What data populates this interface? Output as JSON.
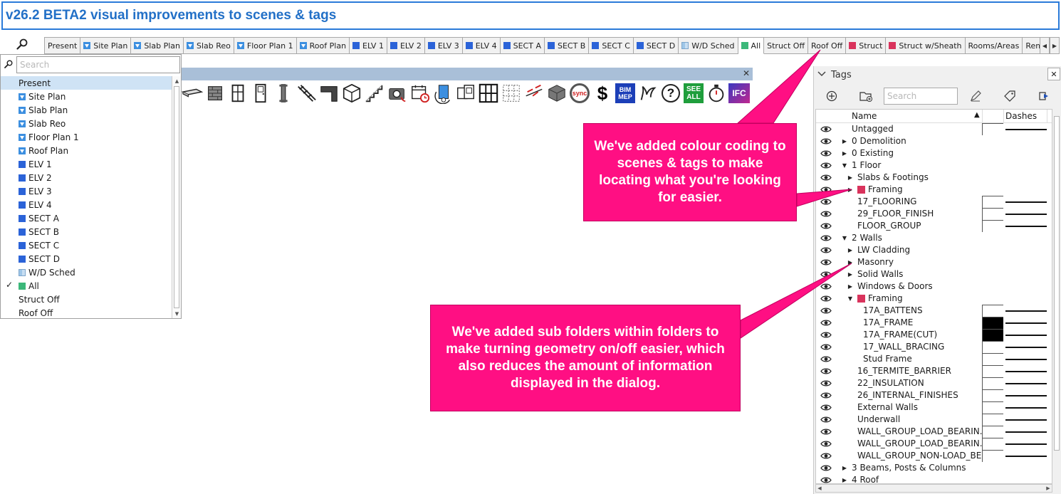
{
  "title": "v26.2 BETA2 visual improvements to scenes & tags",
  "scene_tabs": [
    {
      "label": "Present",
      "swatch": "none",
      "active": false
    },
    {
      "label": "Site Plan",
      "swatch": "tri",
      "active": false
    },
    {
      "label": "Slab Plan",
      "swatch": "tri",
      "active": false
    },
    {
      "label": "Slab Reo",
      "swatch": "tri",
      "active": false
    },
    {
      "label": "Floor Plan 1",
      "swatch": "tri",
      "active": false
    },
    {
      "label": "Roof Plan",
      "swatch": "tri",
      "active": false
    },
    {
      "label": "ELV 1",
      "swatch": "blue",
      "active": false
    },
    {
      "label": "ELV 2",
      "swatch": "blue",
      "active": false
    },
    {
      "label": "ELV 3",
      "swatch": "blue",
      "active": false
    },
    {
      "label": "ELV 4",
      "swatch": "blue",
      "active": false
    },
    {
      "label": "SECT A",
      "swatch": "blue",
      "active": false
    },
    {
      "label": "SECT B",
      "swatch": "blue",
      "active": false
    },
    {
      "label": "SECT C",
      "swatch": "blue",
      "active": false
    },
    {
      "label": "SECT D",
      "swatch": "blue",
      "active": false
    },
    {
      "label": "W/D Sched",
      "swatch": "grid",
      "active": false
    },
    {
      "label": "All",
      "swatch": "green",
      "active": true
    },
    {
      "label": "Struct Off",
      "swatch": "none",
      "active": false
    },
    {
      "label": "Roof Off",
      "swatch": "none",
      "active": false
    },
    {
      "label": "Struct",
      "swatch": "red",
      "active": false
    },
    {
      "label": "Struct w/Sheath",
      "swatch": "red",
      "active": false
    },
    {
      "label": "Rooms/Areas",
      "swatch": "none",
      "active": false
    },
    {
      "label": "Remen",
      "swatch": "none",
      "active": false
    }
  ],
  "scene_dropdown": {
    "search_placeholder": "Search",
    "items": [
      {
        "label": "Present",
        "swatch": "none",
        "checked": false,
        "selected": true
      },
      {
        "label": "Site Plan",
        "swatch": "tri",
        "checked": false,
        "selected": false
      },
      {
        "label": "Slab Plan",
        "swatch": "tri",
        "checked": false,
        "selected": false
      },
      {
        "label": "Slab Reo",
        "swatch": "tri",
        "checked": false,
        "selected": false
      },
      {
        "label": "Floor Plan 1",
        "swatch": "tri",
        "checked": false,
        "selected": false
      },
      {
        "label": "Roof Plan",
        "swatch": "tri",
        "checked": false,
        "selected": false
      },
      {
        "label": "ELV 1",
        "swatch": "blue",
        "checked": false,
        "selected": false
      },
      {
        "label": "ELV 2",
        "swatch": "blue",
        "checked": false,
        "selected": false
      },
      {
        "label": "ELV 3",
        "swatch": "blue",
        "checked": false,
        "selected": false
      },
      {
        "label": "ELV 4",
        "swatch": "blue",
        "checked": false,
        "selected": false
      },
      {
        "label": "SECT A",
        "swatch": "blue",
        "checked": false,
        "selected": false
      },
      {
        "label": "SECT B",
        "swatch": "blue",
        "checked": false,
        "selected": false
      },
      {
        "label": "SECT C",
        "swatch": "blue",
        "checked": false,
        "selected": false
      },
      {
        "label": "SECT D",
        "swatch": "blue",
        "checked": false,
        "selected": false
      },
      {
        "label": "W/D Sched",
        "swatch": "grid",
        "checked": false,
        "selected": false
      },
      {
        "label": "All",
        "swatch": "green",
        "checked": true,
        "selected": false
      },
      {
        "label": "Struct Off",
        "swatch": "none",
        "checked": false,
        "selected": false
      },
      {
        "label": "Roof Off",
        "swatch": "none",
        "checked": false,
        "selected": false
      }
    ]
  },
  "toolbar": {
    "tools": [
      {
        "name": "beam-tool-icon"
      },
      {
        "name": "wall-tool-icon"
      },
      {
        "name": "window-tool-icon"
      },
      {
        "name": "door-tool-icon"
      },
      {
        "name": "column-tool-icon"
      },
      {
        "name": "stair-stringer-tool-icon"
      },
      {
        "name": "corner-tool-icon"
      },
      {
        "name": "solid-tool-icon"
      },
      {
        "name": "stairs-tool-icon"
      },
      {
        "name": "camera-tool-icon"
      },
      {
        "name": "calendar-tool-icon"
      },
      {
        "name": "model-tool-icon"
      },
      {
        "name": "door-schedule-tool-icon"
      },
      {
        "name": "grid-tool-icon"
      },
      {
        "name": "dotted-grid-tool-icon"
      },
      {
        "name": "dimension-tool-icon"
      },
      {
        "name": "component-tool-icon"
      },
      {
        "name": "sync-tool-icon",
        "text": "sync"
      },
      {
        "name": "cost-tool-icon",
        "text": "$"
      },
      {
        "name": "bim-mep-tool-icon",
        "text": "BIM MEP"
      },
      {
        "name": "gesture-tool-icon"
      },
      {
        "name": "help-tool-icon",
        "text": "?"
      },
      {
        "name": "see-all-tool-icon",
        "text": "SEE ALL"
      },
      {
        "name": "timer-tool-icon"
      },
      {
        "name": "ifc-tool-icon",
        "text": "IFC"
      }
    ]
  },
  "tags_panel": {
    "title": "Tags",
    "search_placeholder": "Search",
    "columns": {
      "name": "Name",
      "dashes": "Dashes"
    },
    "rows": [
      {
        "label": "Untagged",
        "level": 0,
        "expander": "none",
        "swatch": false,
        "color_cell": "white",
        "dash": true
      },
      {
        "label": "0 Demolition",
        "level": 0,
        "expander": "collapsed",
        "swatch": false,
        "color_cell": "none",
        "dash": false
      },
      {
        "label": "0 Existing",
        "level": 0,
        "expander": "collapsed",
        "swatch": false,
        "color_cell": "none",
        "dash": false
      },
      {
        "label": "1 Floor",
        "level": 0,
        "expander": "expanded",
        "swatch": false,
        "color_cell": "none",
        "dash": false
      },
      {
        "label": "Slabs & Footings",
        "level": 1,
        "expander": "collapsed",
        "swatch": false,
        "color_cell": "none",
        "dash": false
      },
      {
        "label": "Framing",
        "level": 1,
        "expander": "collapsed",
        "swatch": true,
        "color_cell": "none",
        "dash": false
      },
      {
        "label": "17_FLOORING",
        "level": 1,
        "expander": "none",
        "swatch": false,
        "color_cell": "white",
        "dash": true
      },
      {
        "label": "29_FLOOR_FINISH",
        "level": 1,
        "expander": "none",
        "swatch": false,
        "color_cell": "white",
        "dash": true
      },
      {
        "label": "FLOOR_GROUP",
        "level": 1,
        "expander": "none",
        "swatch": false,
        "color_cell": "white",
        "dash": true
      },
      {
        "label": "2 Walls",
        "level": 0,
        "expander": "expanded",
        "swatch": false,
        "color_cell": "none",
        "dash": false
      },
      {
        "label": "LW Cladding",
        "level": 1,
        "expander": "collapsed",
        "swatch": false,
        "color_cell": "none",
        "dash": false
      },
      {
        "label": "Masonry",
        "level": 1,
        "expander": "collapsed",
        "swatch": false,
        "color_cell": "none",
        "dash": false
      },
      {
        "label": "Solid Walls",
        "level": 1,
        "expander": "collapsed",
        "swatch": false,
        "color_cell": "none",
        "dash": false
      },
      {
        "label": "Windows & Doors",
        "level": 1,
        "expander": "collapsed",
        "swatch": false,
        "color_cell": "none",
        "dash": false
      },
      {
        "label": "Framing",
        "level": 1,
        "expander": "expanded",
        "swatch": true,
        "color_cell": "none",
        "dash": false
      },
      {
        "label": "17A_BATTENS",
        "level": 2,
        "expander": "none",
        "swatch": false,
        "color_cell": "white",
        "dash": true
      },
      {
        "label": "17A_FRAME",
        "level": 2,
        "expander": "none",
        "swatch": false,
        "color_cell": "black",
        "dash": true
      },
      {
        "label": "17A_FRAME(CUT)",
        "level": 2,
        "expander": "none",
        "swatch": false,
        "color_cell": "black",
        "dash": true
      },
      {
        "label": "17_WALL_BRACING",
        "level": 2,
        "expander": "none",
        "swatch": false,
        "color_cell": "white",
        "dash": true
      },
      {
        "label": "Stud Frame",
        "level": 2,
        "expander": "none",
        "swatch": false,
        "color_cell": "white",
        "dash": true
      },
      {
        "label": "16_TERMITE_BARRIER",
        "level": 1,
        "expander": "none",
        "swatch": false,
        "color_cell": "white",
        "dash": true
      },
      {
        "label": "22_INSULATION",
        "level": 1,
        "expander": "none",
        "swatch": false,
        "color_cell": "white",
        "dash": true
      },
      {
        "label": "26_INTERNAL_FINISHES",
        "level": 1,
        "expander": "none",
        "swatch": false,
        "color_cell": "white",
        "dash": true
      },
      {
        "label": "External Walls",
        "level": 1,
        "expander": "none",
        "swatch": false,
        "color_cell": "white",
        "dash": true
      },
      {
        "label": "Underwall",
        "level": 1,
        "expander": "none",
        "swatch": false,
        "color_cell": "white",
        "dash": true
      },
      {
        "label": "WALL_GROUP_LOAD_BEARIN...",
        "level": 1,
        "expander": "none",
        "swatch": false,
        "color_cell": "white",
        "dash": true
      },
      {
        "label": "WALL_GROUP_LOAD_BEARIN...",
        "level": 1,
        "expander": "none",
        "swatch": false,
        "color_cell": "white",
        "dash": true
      },
      {
        "label": "WALL_GROUP_NON-LOAD_BE...",
        "level": 1,
        "expander": "none",
        "swatch": false,
        "color_cell": "white",
        "dash": true
      },
      {
        "label": "3 Beams, Posts & Columns",
        "level": 0,
        "expander": "collapsed",
        "swatch": false,
        "color_cell": "none",
        "dash": false
      },
      {
        "label": "4 Roof",
        "level": 0,
        "expander": "collapsed",
        "swatch": false,
        "color_cell": "none",
        "dash": false
      }
    ]
  },
  "callouts": {
    "first": "We've added colour coding to scenes & tags to make locating what you're looking for easier.",
    "second": "We've added sub folders within folders to make turning geometry on/off easier, which also reduces the amount of information displayed in the dialog."
  },
  "colors": {
    "accent_blue": "#2270c7",
    "callout_pink": "#ff0f83",
    "tag_red": "#d9335c",
    "scene_blue": "#2b63d8",
    "scene_green": "#3cb87a"
  }
}
